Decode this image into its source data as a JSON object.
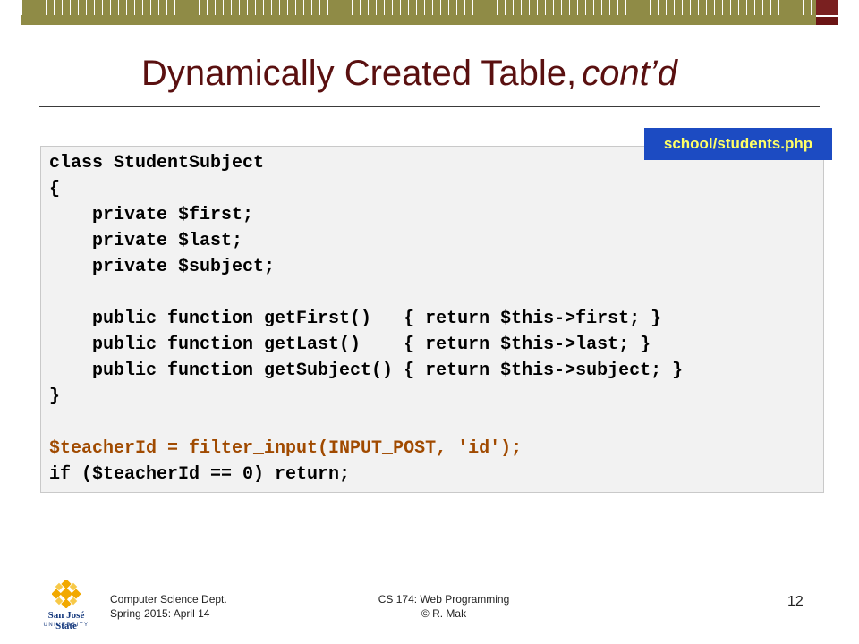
{
  "slide": {
    "title_main": "Dynamically Created Table,",
    "title_italic": "cont’d",
    "file_label": "school/students.php",
    "code_lines": [
      "class StudentSubject",
      "{",
      "    private $first;",
      "    private $last;",
      "    private $subject;",
      "",
      "    public function getFirst()   { return $this->first; }",
      "    public function getLast()    { return $this->last; }",
      "    public function getSubject() { return $this->subject; }",
      "}",
      "",
      "$teacherId = filter_input(INPUT_POST, 'id');",
      "if ($teacherId == 0) return;"
    ]
  },
  "footer": {
    "dept_line1": "Computer Science Dept.",
    "dept_line2": "Spring 2015: April 14",
    "course_line1": "CS 174: Web Programming",
    "course_line2": "© R. Mak",
    "page_number": "12",
    "logo_name": "San José State",
    "logo_sub": "UNIVERSITY"
  },
  "colors": {
    "title": "#5a1010",
    "banner": "#8f8b46",
    "badge_bg": "#1c4bc2",
    "badge_text": "#ffff66",
    "highlight_code": "#a04a00"
  }
}
